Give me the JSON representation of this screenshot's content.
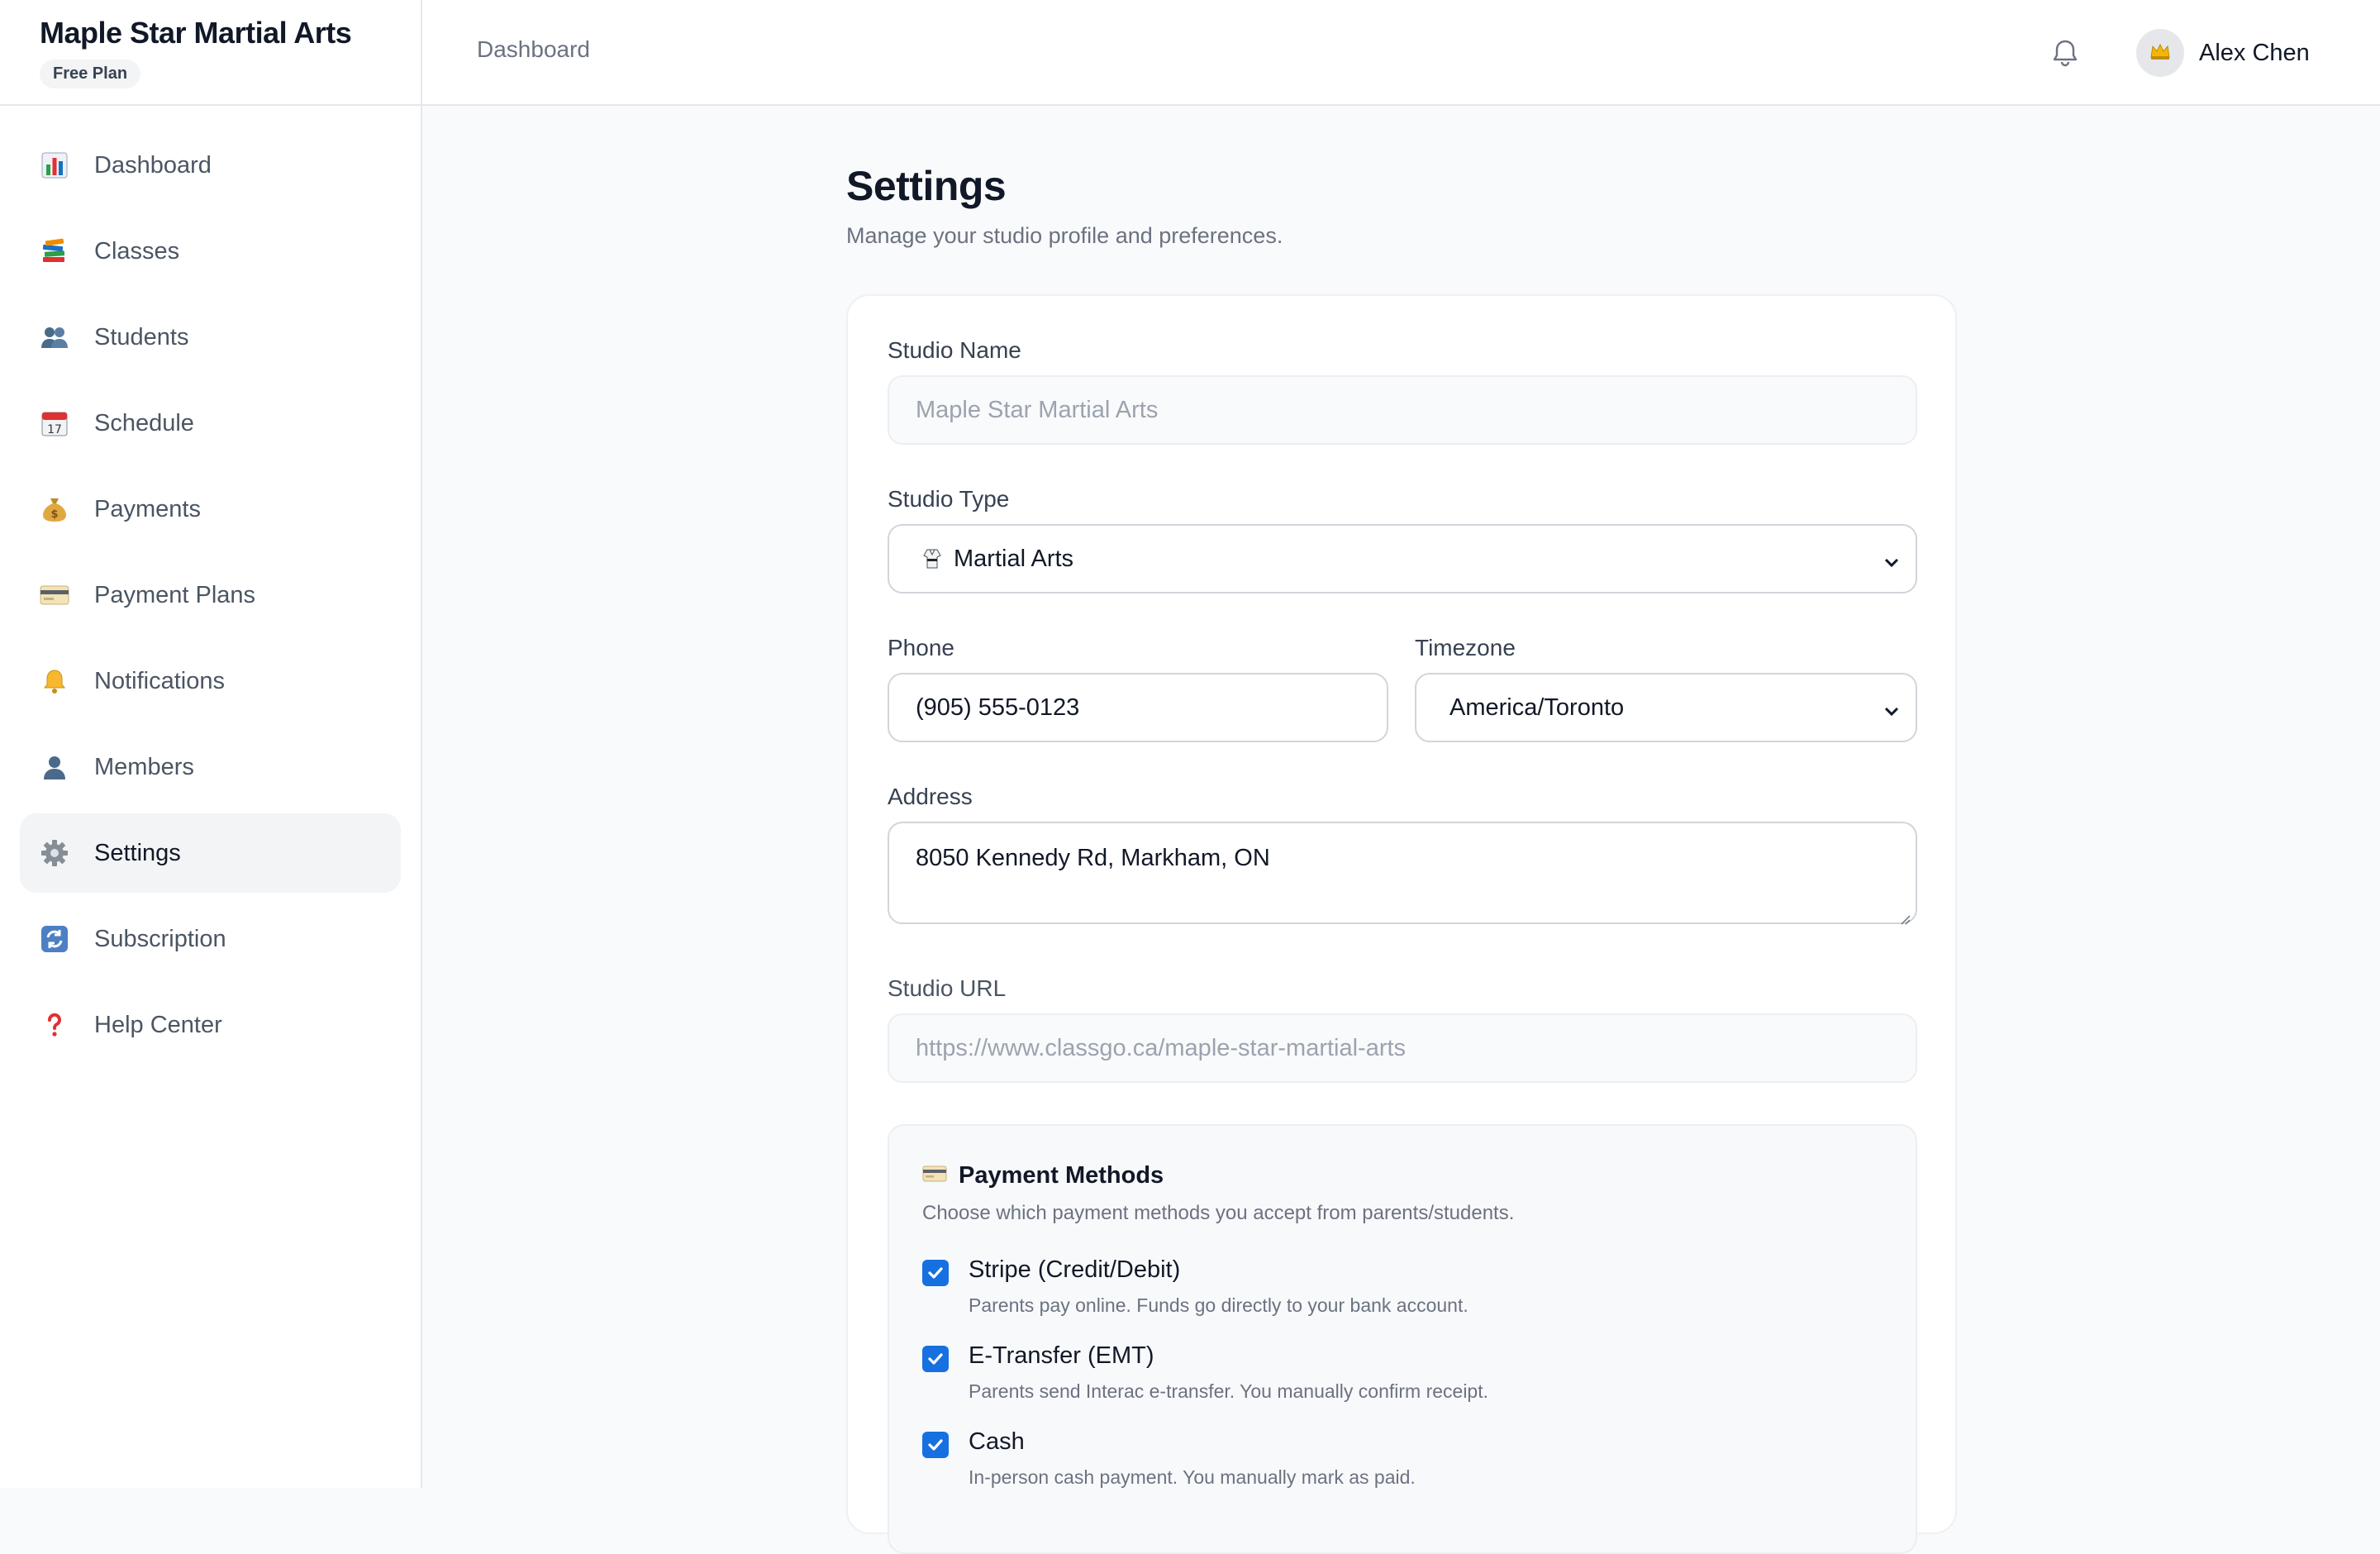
{
  "sidebar": {
    "brand": "Maple Star Martial Arts",
    "plan": "Free Plan",
    "items": [
      {
        "label": "Dashboard",
        "icon": "bar-chart-icon"
      },
      {
        "label": "Classes",
        "icon": "books-icon"
      },
      {
        "label": "Students",
        "icon": "people-icon"
      },
      {
        "label": "Schedule",
        "icon": "calendar-icon"
      },
      {
        "label": "Payments",
        "icon": "money-bag-icon"
      },
      {
        "label": "Payment Plans",
        "icon": "credit-card-icon"
      },
      {
        "label": "Notifications",
        "icon": "bell-icon"
      },
      {
        "label": "Members",
        "icon": "person-icon"
      },
      {
        "label": "Settings",
        "icon": "gear-icon",
        "active": true
      },
      {
        "label": "Subscription",
        "icon": "refresh-icon"
      },
      {
        "label": "Help Center",
        "icon": "question-icon"
      }
    ]
  },
  "header": {
    "breadcrumb": "Dashboard",
    "user_name": "Alex Chen",
    "avatar_icon": "crown-icon"
  },
  "main": {
    "title": "Settings",
    "subtitle": "Manage your studio profile and preferences.",
    "form": {
      "studio_name_label": "Studio Name",
      "studio_name_value": "Maple Star Martial Arts",
      "studio_type_label": "Studio Type",
      "studio_type_value": "Martial Arts",
      "studio_type_icon": "martial-arts-uniform-icon",
      "phone_label": "Phone",
      "phone_value": "(905) 555-0123",
      "timezone_label": "Timezone",
      "timezone_value": "America/Toronto",
      "address_label": "Address",
      "address_value": "8050 Kennedy Rd, Markham, ON",
      "url_label": "Studio URL",
      "url_value": "https://www.classgo.ca/maple-star-martial-arts"
    },
    "payment_methods": {
      "title": "Payment Methods",
      "icon": "credit-card-icon",
      "subtitle": "Choose which payment methods you accept from parents/students.",
      "options": [
        {
          "label": "Stripe (Credit/Debit)",
          "desc": "Parents pay online. Funds go directly to your bank account.",
          "checked": true
        },
        {
          "label": "E-Transfer (EMT)",
          "desc": "Parents send Interac e-transfer. You manually confirm receipt.",
          "checked": true
        },
        {
          "label": "Cash",
          "desc": "In-person cash payment. You manually mark as paid.",
          "checked": true
        }
      ]
    }
  },
  "colors": {
    "accent": "#1670e0",
    "sidebar_active_bg": "#f3f4f6",
    "page_bg": "#f9fafb"
  }
}
